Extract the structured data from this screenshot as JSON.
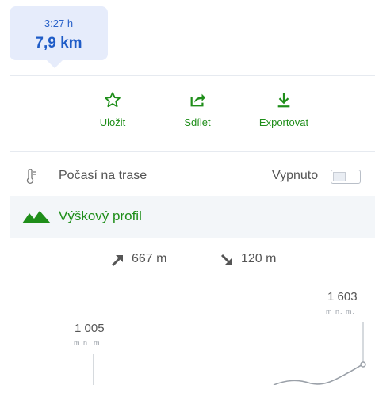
{
  "summary": {
    "duration": "3:27 h",
    "distance": "7,9 km"
  },
  "actions": [
    {
      "label": "Uložit",
      "icon": "star-icon"
    },
    {
      "label": "Sdílet",
      "icon": "share-icon"
    },
    {
      "label": "Exportovat",
      "icon": "download-icon"
    }
  ],
  "weather": {
    "label": "Počasí na trase",
    "toggle_label": "Vypnuto",
    "toggle_on": false,
    "icon": "thermometer-icon"
  },
  "profile": {
    "title": "Výškový profil",
    "icon": "mountain-icon",
    "ascent": "667 m",
    "descent": "120 m",
    "min_elevation": "1 005",
    "min_unit": "m n. m.",
    "max_elevation": "1 603",
    "max_unit": "m n. m."
  },
  "colors": {
    "accent_green": "#1f8e1a",
    "bubble_bg": "#e6ecfb",
    "distance_blue": "#1f5cc7"
  }
}
